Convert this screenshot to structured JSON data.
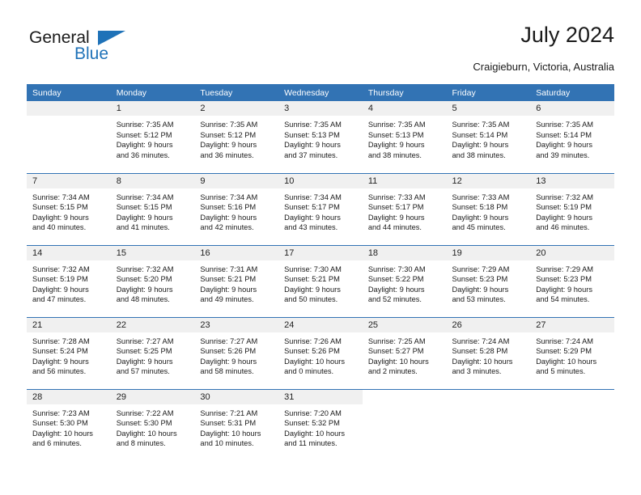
{
  "logo": {
    "word_one": "General",
    "word_two": "Blue",
    "triangle_color": "#1f72b8"
  },
  "header": {
    "title": "July 2024",
    "subtitle": "Craigieburn, Victoria, Australia"
  },
  "theme": {
    "header_blue": "#3273b4",
    "daynum_gray": "#f0f0f0",
    "text": "#1a1a1a"
  },
  "weekdays": [
    "Sunday",
    "Monday",
    "Tuesday",
    "Wednesday",
    "Thursday",
    "Friday",
    "Saturday"
  ],
  "weeks": [
    [
      {
        "day": "",
        "empty": true
      },
      {
        "day": "1",
        "sunrise": "Sunrise: 7:35 AM",
        "sunset": "Sunset: 5:12 PM",
        "daylight_a": "Daylight: 9 hours",
        "daylight_b": "and 36 minutes."
      },
      {
        "day": "2",
        "sunrise": "Sunrise: 7:35 AM",
        "sunset": "Sunset: 5:12 PM",
        "daylight_a": "Daylight: 9 hours",
        "daylight_b": "and 36 minutes."
      },
      {
        "day": "3",
        "sunrise": "Sunrise: 7:35 AM",
        "sunset": "Sunset: 5:13 PM",
        "daylight_a": "Daylight: 9 hours",
        "daylight_b": "and 37 minutes."
      },
      {
        "day": "4",
        "sunrise": "Sunrise: 7:35 AM",
        "sunset": "Sunset: 5:13 PM",
        "daylight_a": "Daylight: 9 hours",
        "daylight_b": "and 38 minutes."
      },
      {
        "day": "5",
        "sunrise": "Sunrise: 7:35 AM",
        "sunset": "Sunset: 5:14 PM",
        "daylight_a": "Daylight: 9 hours",
        "daylight_b": "and 38 minutes."
      },
      {
        "day": "6",
        "sunrise": "Sunrise: 7:35 AM",
        "sunset": "Sunset: 5:14 PM",
        "daylight_a": "Daylight: 9 hours",
        "daylight_b": "and 39 minutes."
      }
    ],
    [
      {
        "day": "7",
        "sunrise": "Sunrise: 7:34 AM",
        "sunset": "Sunset: 5:15 PM",
        "daylight_a": "Daylight: 9 hours",
        "daylight_b": "and 40 minutes."
      },
      {
        "day": "8",
        "sunrise": "Sunrise: 7:34 AM",
        "sunset": "Sunset: 5:15 PM",
        "daylight_a": "Daylight: 9 hours",
        "daylight_b": "and 41 minutes."
      },
      {
        "day": "9",
        "sunrise": "Sunrise: 7:34 AM",
        "sunset": "Sunset: 5:16 PM",
        "daylight_a": "Daylight: 9 hours",
        "daylight_b": "and 42 minutes."
      },
      {
        "day": "10",
        "sunrise": "Sunrise: 7:34 AM",
        "sunset": "Sunset: 5:17 PM",
        "daylight_a": "Daylight: 9 hours",
        "daylight_b": "and 43 minutes."
      },
      {
        "day": "11",
        "sunrise": "Sunrise: 7:33 AM",
        "sunset": "Sunset: 5:17 PM",
        "daylight_a": "Daylight: 9 hours",
        "daylight_b": "and 44 minutes."
      },
      {
        "day": "12",
        "sunrise": "Sunrise: 7:33 AM",
        "sunset": "Sunset: 5:18 PM",
        "daylight_a": "Daylight: 9 hours",
        "daylight_b": "and 45 minutes."
      },
      {
        "day": "13",
        "sunrise": "Sunrise: 7:32 AM",
        "sunset": "Sunset: 5:19 PM",
        "daylight_a": "Daylight: 9 hours",
        "daylight_b": "and 46 minutes."
      }
    ],
    [
      {
        "day": "14",
        "sunrise": "Sunrise: 7:32 AM",
        "sunset": "Sunset: 5:19 PM",
        "daylight_a": "Daylight: 9 hours",
        "daylight_b": "and 47 minutes."
      },
      {
        "day": "15",
        "sunrise": "Sunrise: 7:32 AM",
        "sunset": "Sunset: 5:20 PM",
        "daylight_a": "Daylight: 9 hours",
        "daylight_b": "and 48 minutes."
      },
      {
        "day": "16",
        "sunrise": "Sunrise: 7:31 AM",
        "sunset": "Sunset: 5:21 PM",
        "daylight_a": "Daylight: 9 hours",
        "daylight_b": "and 49 minutes."
      },
      {
        "day": "17",
        "sunrise": "Sunrise: 7:30 AM",
        "sunset": "Sunset: 5:21 PM",
        "daylight_a": "Daylight: 9 hours",
        "daylight_b": "and 50 minutes."
      },
      {
        "day": "18",
        "sunrise": "Sunrise: 7:30 AM",
        "sunset": "Sunset: 5:22 PM",
        "daylight_a": "Daylight: 9 hours",
        "daylight_b": "and 52 minutes."
      },
      {
        "day": "19",
        "sunrise": "Sunrise: 7:29 AM",
        "sunset": "Sunset: 5:23 PM",
        "daylight_a": "Daylight: 9 hours",
        "daylight_b": "and 53 minutes."
      },
      {
        "day": "20",
        "sunrise": "Sunrise: 7:29 AM",
        "sunset": "Sunset: 5:23 PM",
        "daylight_a": "Daylight: 9 hours",
        "daylight_b": "and 54 minutes."
      }
    ],
    [
      {
        "day": "21",
        "sunrise": "Sunrise: 7:28 AM",
        "sunset": "Sunset: 5:24 PM",
        "daylight_a": "Daylight: 9 hours",
        "daylight_b": "and 56 minutes."
      },
      {
        "day": "22",
        "sunrise": "Sunrise: 7:27 AM",
        "sunset": "Sunset: 5:25 PM",
        "daylight_a": "Daylight: 9 hours",
        "daylight_b": "and 57 minutes."
      },
      {
        "day": "23",
        "sunrise": "Sunrise: 7:27 AM",
        "sunset": "Sunset: 5:26 PM",
        "daylight_a": "Daylight: 9 hours",
        "daylight_b": "and 58 minutes."
      },
      {
        "day": "24",
        "sunrise": "Sunrise: 7:26 AM",
        "sunset": "Sunset: 5:26 PM",
        "daylight_a": "Daylight: 10 hours",
        "daylight_b": "and 0 minutes."
      },
      {
        "day": "25",
        "sunrise": "Sunrise: 7:25 AM",
        "sunset": "Sunset: 5:27 PM",
        "daylight_a": "Daylight: 10 hours",
        "daylight_b": "and 2 minutes."
      },
      {
        "day": "26",
        "sunrise": "Sunrise: 7:24 AM",
        "sunset": "Sunset: 5:28 PM",
        "daylight_a": "Daylight: 10 hours",
        "daylight_b": "and 3 minutes."
      },
      {
        "day": "27",
        "sunrise": "Sunrise: 7:24 AM",
        "sunset": "Sunset: 5:29 PM",
        "daylight_a": "Daylight: 10 hours",
        "daylight_b": "and 5 minutes."
      }
    ],
    [
      {
        "day": "28",
        "sunrise": "Sunrise: 7:23 AM",
        "sunset": "Sunset: 5:30 PM",
        "daylight_a": "Daylight: 10 hours",
        "daylight_b": "and 6 minutes."
      },
      {
        "day": "29",
        "sunrise": "Sunrise: 7:22 AM",
        "sunset": "Sunset: 5:30 PM",
        "daylight_a": "Daylight: 10 hours",
        "daylight_b": "and 8 minutes."
      },
      {
        "day": "30",
        "sunrise": "Sunrise: 7:21 AM",
        "sunset": "Sunset: 5:31 PM",
        "daylight_a": "Daylight: 10 hours",
        "daylight_b": "and 10 minutes."
      },
      {
        "day": "31",
        "sunrise": "Sunrise: 7:20 AM",
        "sunset": "Sunset: 5:32 PM",
        "daylight_a": "Daylight: 10 hours",
        "daylight_b": "and 11 minutes."
      },
      {
        "day": "",
        "empty": true,
        "blank": true
      },
      {
        "day": "",
        "empty": true,
        "blank": true
      },
      {
        "day": "",
        "empty": true,
        "blank": true
      }
    ]
  ]
}
